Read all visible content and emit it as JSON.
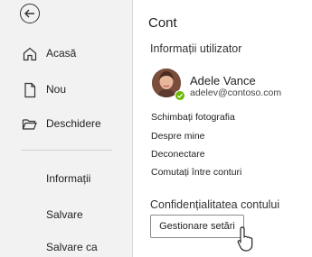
{
  "sidebar": {
    "back": "back-arrow-icon",
    "items": [
      {
        "label": "Acasă",
        "icon": "home-icon"
      },
      {
        "label": "Nou",
        "icon": "new-document-icon"
      },
      {
        "label": "Deschidere",
        "icon": "folder-open-icon"
      }
    ],
    "sub_items": [
      "Informații",
      "Salvare",
      "Salvare ca"
    ]
  },
  "main": {
    "title": "Cont",
    "user_info_heading": "Informații utilizator",
    "user": {
      "name": "Adele Vance",
      "email": "adelev@contoso.com",
      "status_color": "#6bb700"
    },
    "links": [
      "Schimbați fotografia",
      "Despre mine",
      "Deconectare",
      "Comutați între conturi"
    ],
    "privacy_heading": "Confidențialitatea contului",
    "manage_button": "Gestionare setări"
  }
}
